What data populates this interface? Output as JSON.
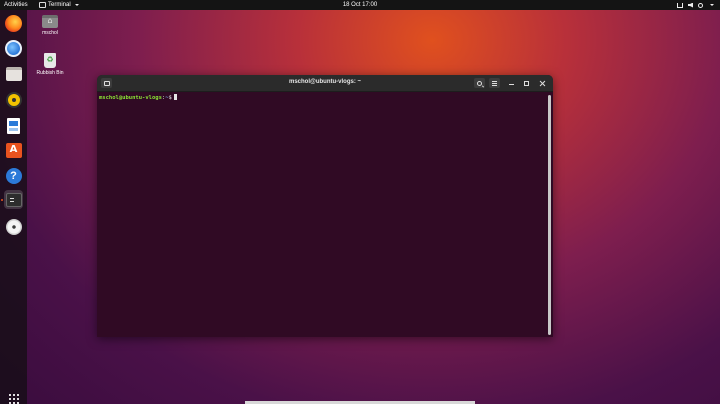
{
  "topbar": {
    "activities": "Activities",
    "app_menu": "Terminal",
    "clock": "18 Oct  17:00",
    "tray_icons": [
      "network-icon",
      "volume-icon",
      "power-icon"
    ]
  },
  "dock": {
    "items": [
      "firefox-icon",
      "thunderbird-icon",
      "files-icon",
      "rhythmbox-icon",
      "libreoffice-writer-icon",
      "ubuntu-software-icon",
      "help-icon",
      "terminal-icon",
      "disc-icon"
    ],
    "active": "terminal-icon",
    "show_apps": "show-applications-icon"
  },
  "desktop": {
    "icons": [
      {
        "label": "mschol",
        "icon": "home-folder-icon"
      },
      {
        "label": "Rubbish Bin",
        "icon": "trash-icon"
      }
    ]
  },
  "terminal": {
    "title": "mschol@ubuntu-vlogs: ~",
    "prompt_user": "mschol@ubuntu-vlogs",
    "prompt_sep": ":",
    "prompt_path": "~",
    "prompt_symbol": "$"
  },
  "colors": {
    "terminal_bg": "#300a24",
    "titlebar_bg": "#2b2b2b",
    "prompt_user": "#8ae234",
    "prompt_path": "#729fcf",
    "ubuntu_orange": "#e95420"
  }
}
